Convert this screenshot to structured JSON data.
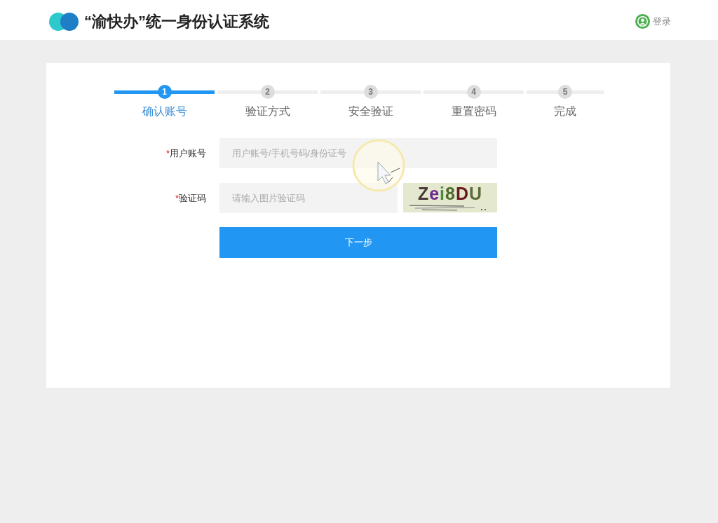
{
  "header": {
    "title": "“渝快办”统一身份认证系统",
    "login_link": "登录"
  },
  "steps": [
    {
      "number": "1",
      "label": "确认账号",
      "selected": true
    },
    {
      "number": "2",
      "label": "验证方式",
      "selected": false
    },
    {
      "number": "3",
      "label": "安全验证",
      "selected": false
    },
    {
      "number": "4",
      "label": "重置密码",
      "selected": false
    },
    {
      "number": "5",
      "label": "完成",
      "selected": false
    }
  ],
  "form": {
    "fields": [
      {
        "kind": "text",
        "required_mark": "*",
        "label": "用户账号",
        "placeholder": "用户账号/手机号码/身份证号"
      },
      {
        "kind": "captcha",
        "required_mark": "*",
        "label": "验证码",
        "placeholder": "请输入图片验证码",
        "captcha_text": "Zei8DU"
      }
    ],
    "submit_button": "下一步"
  }
}
